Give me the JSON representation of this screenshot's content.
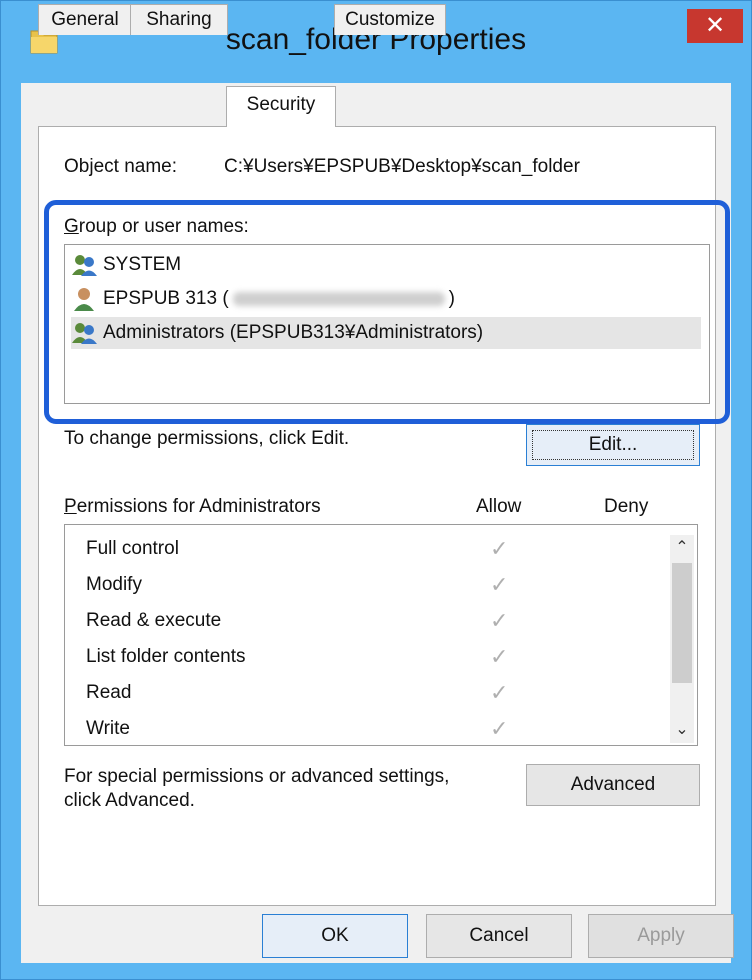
{
  "window": {
    "title": "scan_folder Properties",
    "close_glyph": "✕"
  },
  "tabs": [
    {
      "label": "General"
    },
    {
      "label": "Sharing"
    },
    {
      "label": "Security"
    },
    {
      "label": "Customize"
    }
  ],
  "object": {
    "label": "Object name:",
    "value": "C:¥Users¥EPSPUB¥Desktop¥scan_folder"
  },
  "group_users": {
    "label": "Group or user names:",
    "items": [
      {
        "name": "SYSTEM",
        "icon": "group-icon"
      },
      {
        "name": "EPSPUB 313 (",
        "suffix": ")",
        "icon": "user-icon"
      },
      {
        "name": "Administrators (EPSPUB313¥Administrators)",
        "icon": "group-icon",
        "selected": true
      }
    ]
  },
  "change_text": "To change permissions, click Edit.",
  "edit_button": "Edit...",
  "permissions": {
    "header": "Permissions for Administrators",
    "allow_label": "Allow",
    "deny_label": "Deny",
    "check_glyph": "✓",
    "rows": [
      {
        "name": "Full control",
        "allow": true
      },
      {
        "name": "Modify",
        "allow": true
      },
      {
        "name": "Read & execute",
        "allow": true
      },
      {
        "name": "List folder contents",
        "allow": true
      },
      {
        "name": "Read",
        "allow": true
      },
      {
        "name": "Write",
        "allow": true
      }
    ]
  },
  "advanced_text_line1": "For special permissions or advanced settings,",
  "advanced_text_line2": "click Advanced.",
  "advanced_button": "Advanced",
  "footer": {
    "ok": "OK",
    "cancel": "Cancel",
    "apply": "Apply"
  },
  "colors": {
    "frame": "#5bb6f2",
    "close": "#c7372f",
    "highlight": "#1f5fd8"
  }
}
